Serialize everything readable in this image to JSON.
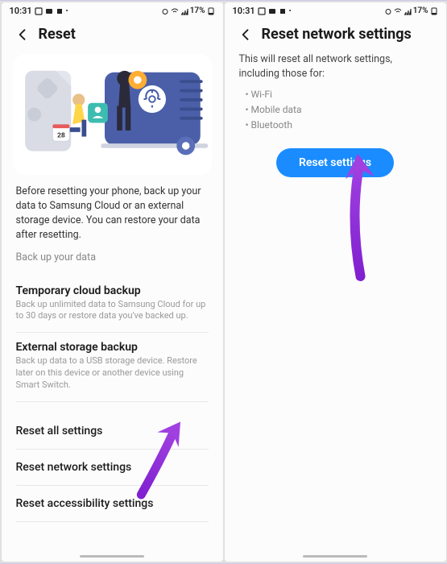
{
  "status": {
    "time": "10:31",
    "battery": "17%"
  },
  "left": {
    "header_title": "Reset",
    "description": "Before resetting your phone, back up your data to Samsung Cloud or an external storage device. You can restore your data after resetting.",
    "backup_link": "Back up your data",
    "sections": [
      {
        "title": "Temporary cloud backup",
        "sub": "Back up unlimited data to Samsung Cloud for up to 30 days or restore data you've backed up."
      },
      {
        "title": "External storage backup",
        "sub": "Back up data to a USB storage device. Restore later on this device or another device using Smart Switch."
      }
    ],
    "items": [
      "Reset all settings",
      "Reset network settings",
      "Reset accessibility settings"
    ]
  },
  "right": {
    "header_title": "Reset network settings",
    "info": "This will reset all network settings, including those for:",
    "bullets": [
      "Wi-Fi",
      "Mobile data",
      "Bluetooth"
    ],
    "button": "Reset settings"
  },
  "illustration": {
    "calendar_day": "28"
  }
}
